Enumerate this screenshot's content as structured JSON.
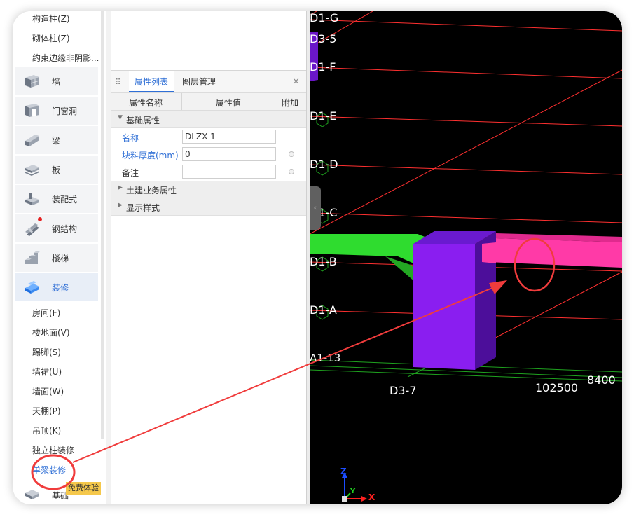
{
  "tree": {
    "top_items": [
      "构造柱(Z)",
      "砌体柱(Z)",
      "约束边缘非阴影..."
    ],
    "categories": [
      {
        "label": "墙",
        "icon": "wall-icon"
      },
      {
        "label": "门窗洞",
        "icon": "door-window-icon"
      },
      {
        "label": "梁",
        "icon": "beam-icon"
      },
      {
        "label": "板",
        "icon": "slab-icon"
      },
      {
        "label": "装配式",
        "icon": "prefab-icon"
      },
      {
        "label": "钢结构",
        "icon": "steel-structure-icon"
      },
      {
        "label": "楼梯",
        "icon": "stairs-icon"
      },
      {
        "label": "装修",
        "icon": "decoration-icon"
      }
    ],
    "decoration_items": [
      "房间(F)",
      "楼地面(V)",
      "踢脚(S)",
      "墙裙(U)",
      "墙面(W)",
      "天棚(P)",
      "吊顶(K)",
      "独立柱装修",
      "单梁装修"
    ],
    "bottom_label": "基础",
    "free_trial_badge": "免费体验"
  },
  "properties": {
    "tabs": [
      "属性列表",
      "图层管理"
    ],
    "close_glyph": "×",
    "columns": [
      "属性名称",
      "属性值",
      "附加"
    ],
    "groups": [
      {
        "title": "基础属性",
        "expanded": true
      },
      {
        "title": "土建业务属性",
        "expanded": false
      },
      {
        "title": "显示样式",
        "expanded": false
      }
    ],
    "rows": [
      {
        "name": "名称",
        "value": "DLZX-1"
      },
      {
        "name": "块料厚度(mm)",
        "value": "0"
      },
      {
        "name": "备注",
        "value": ""
      }
    ]
  },
  "viewport": {
    "axis_labels": [
      "D1-G",
      "D3-5",
      "D1-F",
      "D1-E",
      "D1-D",
      "D1-C",
      "D1-B",
      "D1-A",
      "A1-13",
      "D3-7"
    ],
    "dimensions": [
      "102500",
      "8400"
    ],
    "axes": {
      "x": "X",
      "y": "Y",
      "z": "Z"
    },
    "colors": {
      "beam_green": "#2fdc2f",
      "beam_pink": "#ff3aa7",
      "column_purple": "#8a1ef0",
      "grid_red": "#ff3030",
      "annotation_red": "#f03c3c"
    }
  }
}
